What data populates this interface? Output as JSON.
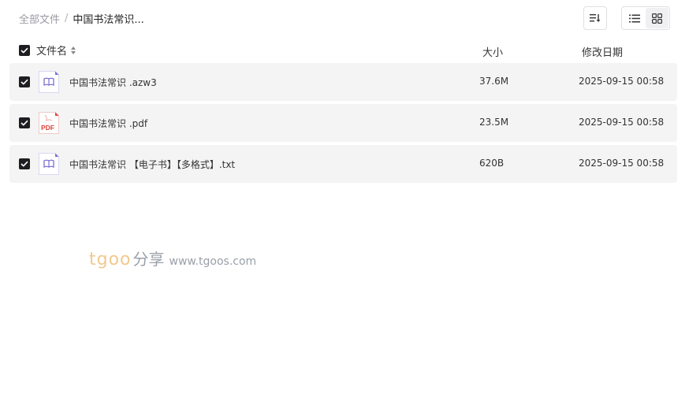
{
  "breadcrumb": {
    "root": "全部文件",
    "separator": "/",
    "current": "中国书法常识..."
  },
  "header": {
    "name": "文件名",
    "size": "大小",
    "date": "修改日期"
  },
  "files": [
    {
      "name": "中国书法常识 .azw3",
      "size": "37.6M",
      "date": "2025-09-15 00:58",
      "icon": "ebook-icon"
    },
    {
      "name": "中国书法常识 .pdf",
      "size": "23.5M",
      "date": "2025-09-15 00:58",
      "icon": "pdf-icon",
      "icon_label": "PDF"
    },
    {
      "name": "中国书法常识 【电子书】【多格式】.txt",
      "size": "620B",
      "date": "2025-09-15 00:58",
      "icon": "ebook-icon"
    }
  ],
  "watermark": {
    "brand": "tgoo",
    "share": "分享",
    "url": "www.tgoos.com"
  },
  "colors": {
    "ebook_icon": "#7b6fd6",
    "pdf_icon": "#e0453a",
    "row_bg": "#f4f4f5"
  }
}
